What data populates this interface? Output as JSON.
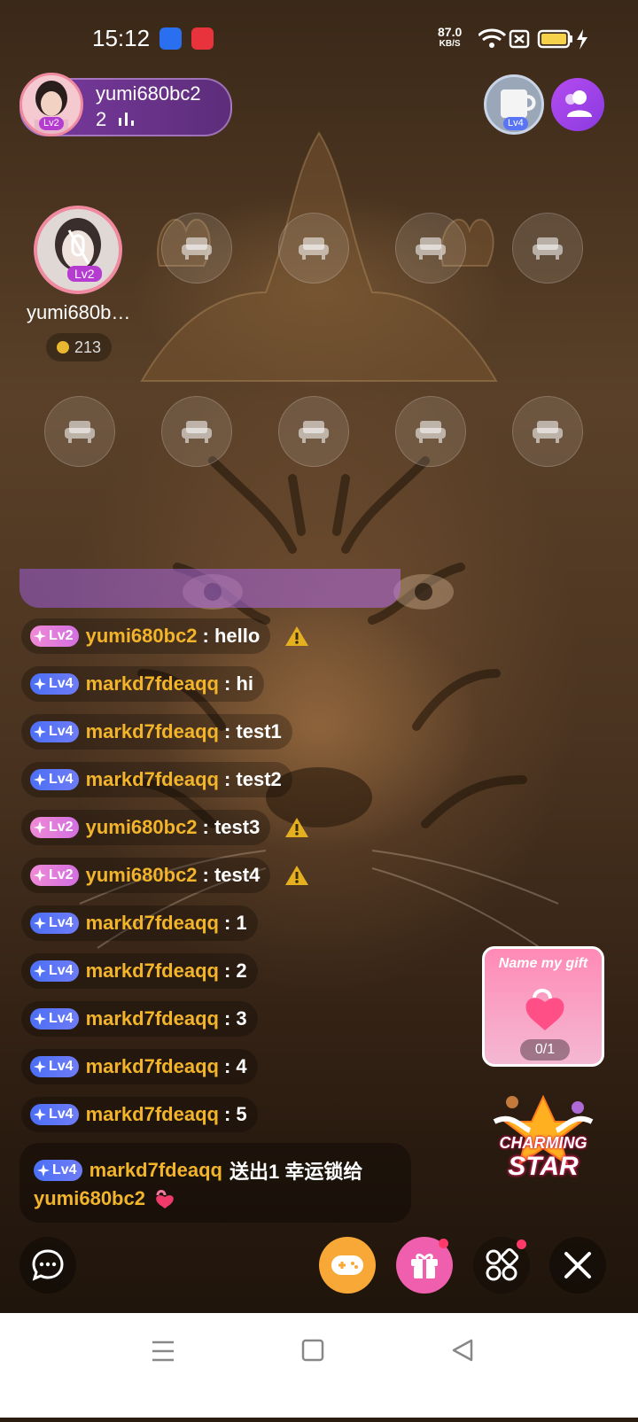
{
  "status_bar": {
    "time": "15:12",
    "net_speed_value": "87.0",
    "net_speed_unit": "KB/S",
    "icons": [
      "baidu-app-icon",
      "screen-record-icon",
      "wifi-icon",
      "sim-off-icon",
      "battery-icon",
      "charging-icon"
    ]
  },
  "host": {
    "name": "yumi680bc2",
    "viewer_count": "2",
    "level": "Lv2"
  },
  "top_right": {
    "avatar_level": "Lv4"
  },
  "seats": {
    "host_seat_name": "yumi680b…",
    "host_seat_level": "Lv2",
    "host_coins": "213"
  },
  "chat": [
    {
      "level": "Lv2",
      "user": "yumi680bc2",
      "text": ": hello",
      "warning": true
    },
    {
      "level": "Lv4",
      "user": "markd7fdeaqq",
      "text": ": hi",
      "warning": false
    },
    {
      "level": "Lv4",
      "user": "markd7fdeaqq",
      "text": ": test1",
      "warning": false
    },
    {
      "level": "Lv4",
      "user": "markd7fdeaqq",
      "text": ": test2",
      "warning": false
    },
    {
      "level": "Lv2",
      "user": "yumi680bc2",
      "text": ": test3",
      "warning": true
    },
    {
      "level": "Lv2",
      "user": "yumi680bc2",
      "text": ": test4",
      "warning": true
    },
    {
      "level": "Lv4",
      "user": "markd7fdeaqq",
      "text": ": 1",
      "warning": false
    },
    {
      "level": "Lv4",
      "user": "markd7fdeaqq",
      "text": ": 2",
      "warning": false
    },
    {
      "level": "Lv4",
      "user": "markd7fdeaqq",
      "text": ": 3",
      "warning": false
    },
    {
      "level": "Lv4",
      "user": "markd7fdeaqq",
      "text": ": 4",
      "warning": false
    },
    {
      "level": "Lv4",
      "user": "markd7fdeaqq",
      "text": ": 5",
      "warning": false
    }
  ],
  "gift_message": {
    "level": "Lv4",
    "sender": "markd7fdeaqq",
    "action": "送出1 幸运锁给",
    "receiver": "yumi680bc2"
  },
  "name_my_gift": {
    "title": "Name my gift",
    "progress": "0/1"
  },
  "charming_star": {
    "line1": "CHARMING",
    "line2": "STAR"
  },
  "colors": {
    "username": "#f2b42a",
    "lv2_badge": "#e57fd9",
    "lv4_badge": "#5a74f6",
    "gift_button": "#ef5fae",
    "game_button": "#f8a837",
    "notification_dot": "#ff3a6a"
  }
}
